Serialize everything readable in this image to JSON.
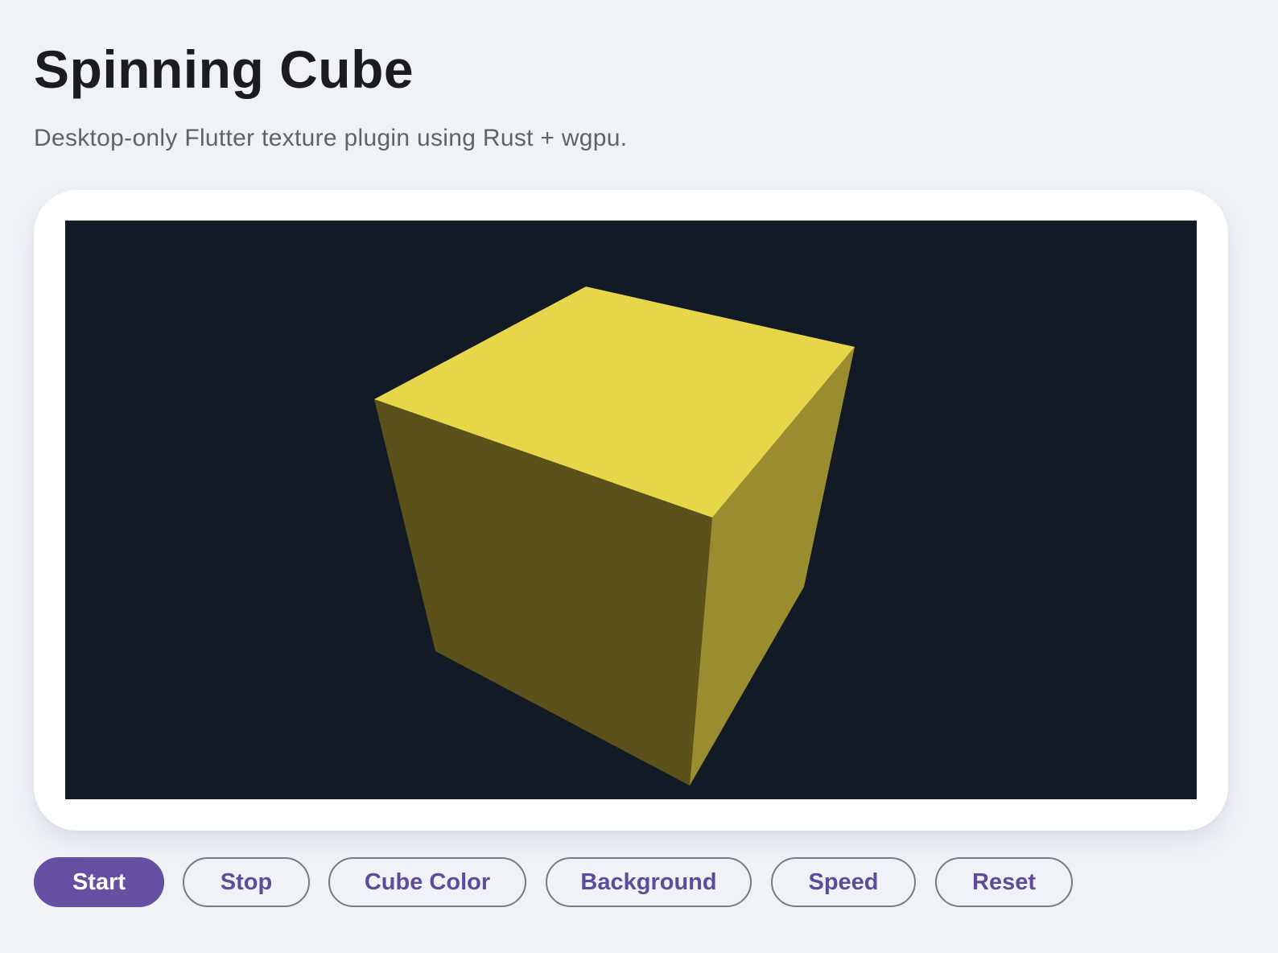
{
  "header": {
    "title": "Spinning Cube",
    "subtitle": "Desktop-only Flutter texture plugin using Rust + wgpu."
  },
  "viewport": {
    "background_color": "#111a25",
    "cube": {
      "top_face_color": "#e7d54a",
      "front_face_color": "#5b511b",
      "side_face_color": "#9a8d2f"
    }
  },
  "controls": {
    "start_label": "Start",
    "stop_label": "Stop",
    "cube_color_label": "Cube Color",
    "background_label": "Background",
    "speed_label": "Speed",
    "reset_label": "Reset"
  },
  "colors": {
    "page_background": "#eff3f8",
    "primary": "#6750a4",
    "button_text": "#5f4b9a",
    "button_outline": "#7a7880"
  }
}
